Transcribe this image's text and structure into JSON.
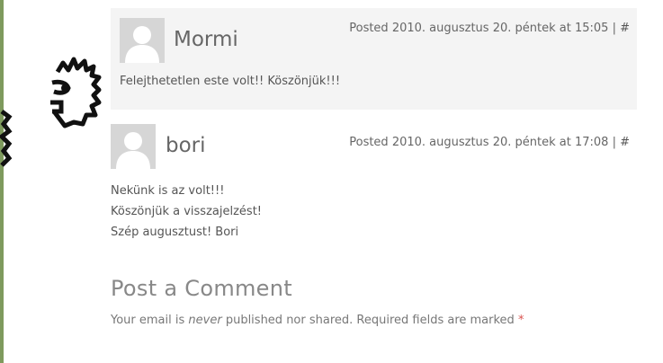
{
  "comments": [
    {
      "author": "Mormi",
      "posted": "Posted 2010. augusztus 20. péntek at 15:05",
      "separator": "|",
      "permalink": "#",
      "text": "Felejthetetlen este volt!! Köszönjük!!!"
    },
    {
      "author": "bori",
      "posted": "Posted 2010. augusztus 20. péntek at 17:08",
      "separator": "|",
      "permalink": "#",
      "lines": [
        "Nekünk is az volt!!!",
        "Köszönjük a visszajelzést!",
        "Szép augusztust! Bori"
      ]
    }
  ],
  "form": {
    "title": "Post a Comment",
    "notice_before": "Your email is",
    "notice_em": "never",
    "notice_after": "published nor shared. Required fields are marked",
    "required_mark": "*"
  },
  "colors": {
    "accent_border": "#7e9a5d",
    "comment_bg": "#f4f4f4",
    "required": "#d9534f"
  },
  "icons": [
    "default-avatar-icon",
    "doodle-face-icon"
  ]
}
